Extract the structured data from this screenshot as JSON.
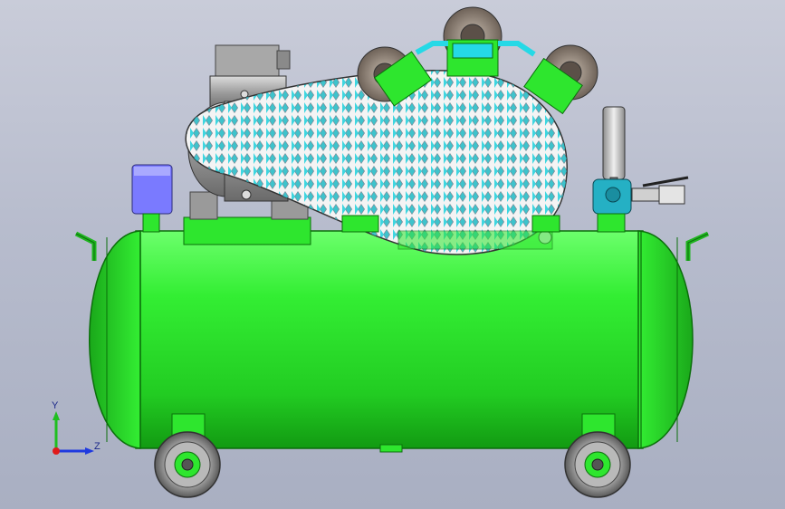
{
  "viewport": {
    "background_top": "#c9ccd9",
    "background_bottom": "#a9afc2"
  },
  "model": {
    "tank_color": "#2ee62e",
    "tank_shadow": "#12a012",
    "guard_pattern": "diamond-mesh",
    "accent_color": "#25d9e6"
  },
  "triad": {
    "y_label": "Y",
    "z_label": "Z",
    "y_color": "#1fbf1f",
    "z_color": "#1f3adf",
    "x_color": "#e01a1a"
  }
}
